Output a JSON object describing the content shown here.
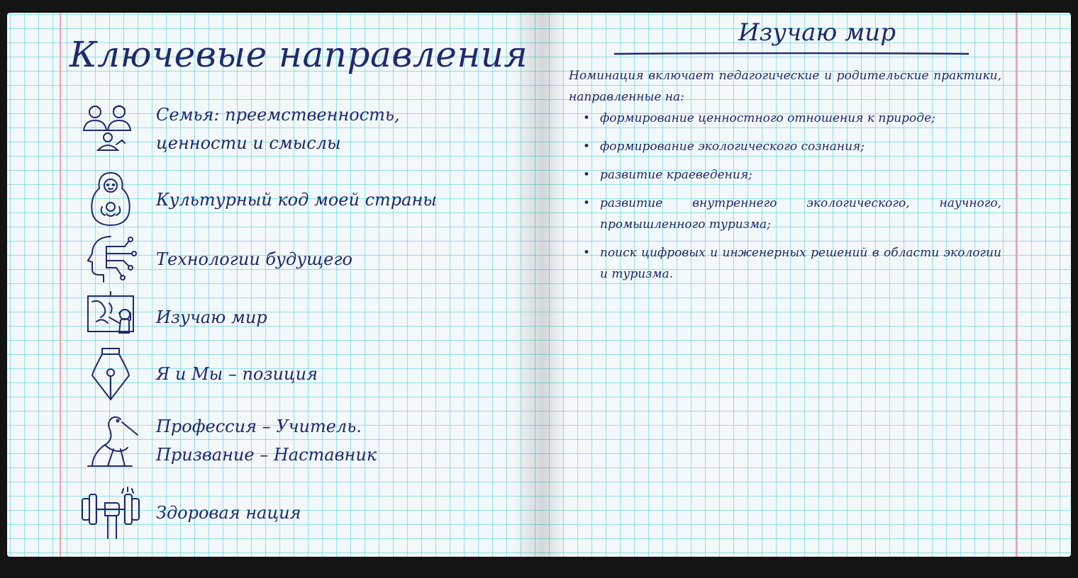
{
  "left_page": {
    "title": "Ключевые направления",
    "directions": [
      {
        "icon": "family-icon",
        "label": "Семья: преемственность,\nценности и смыслы"
      },
      {
        "icon": "matryoshka-icon",
        "label": "Культурный код моей страны"
      },
      {
        "icon": "circuit-head-icon",
        "label": "Технологии будущего"
      },
      {
        "icon": "map-board-icon",
        "label": "Изучаю мир"
      },
      {
        "icon": "pen-nib-icon",
        "label": "Я и Мы – позиция"
      },
      {
        "icon": "stork-icon",
        "label": "Профессия – Учитель.\nПризвание – Наставник"
      },
      {
        "icon": "dumbbell-icon",
        "label": "Здоровая нация"
      }
    ]
  },
  "right_page": {
    "title": "Изучаю мир",
    "intro": "Номинация включает педагогические и родительские практики, направленные на:",
    "bullet_symbol": "•",
    "bullets": [
      "формирование ценностного отношения к природе;",
      "формирование экологического сознания;",
      "развитие краеведения;",
      "развитие внутреннего экологического, научного, промышленного туризма;",
      "поиск цифровых и инженерных решений в области экологии и туризма."
    ]
  },
  "colors": {
    "ink": "#1f2a6b",
    "grid": "#46c8d7",
    "margin_line": "#e88a9a",
    "paper": "#f3f8fa",
    "background": "#141414"
  }
}
